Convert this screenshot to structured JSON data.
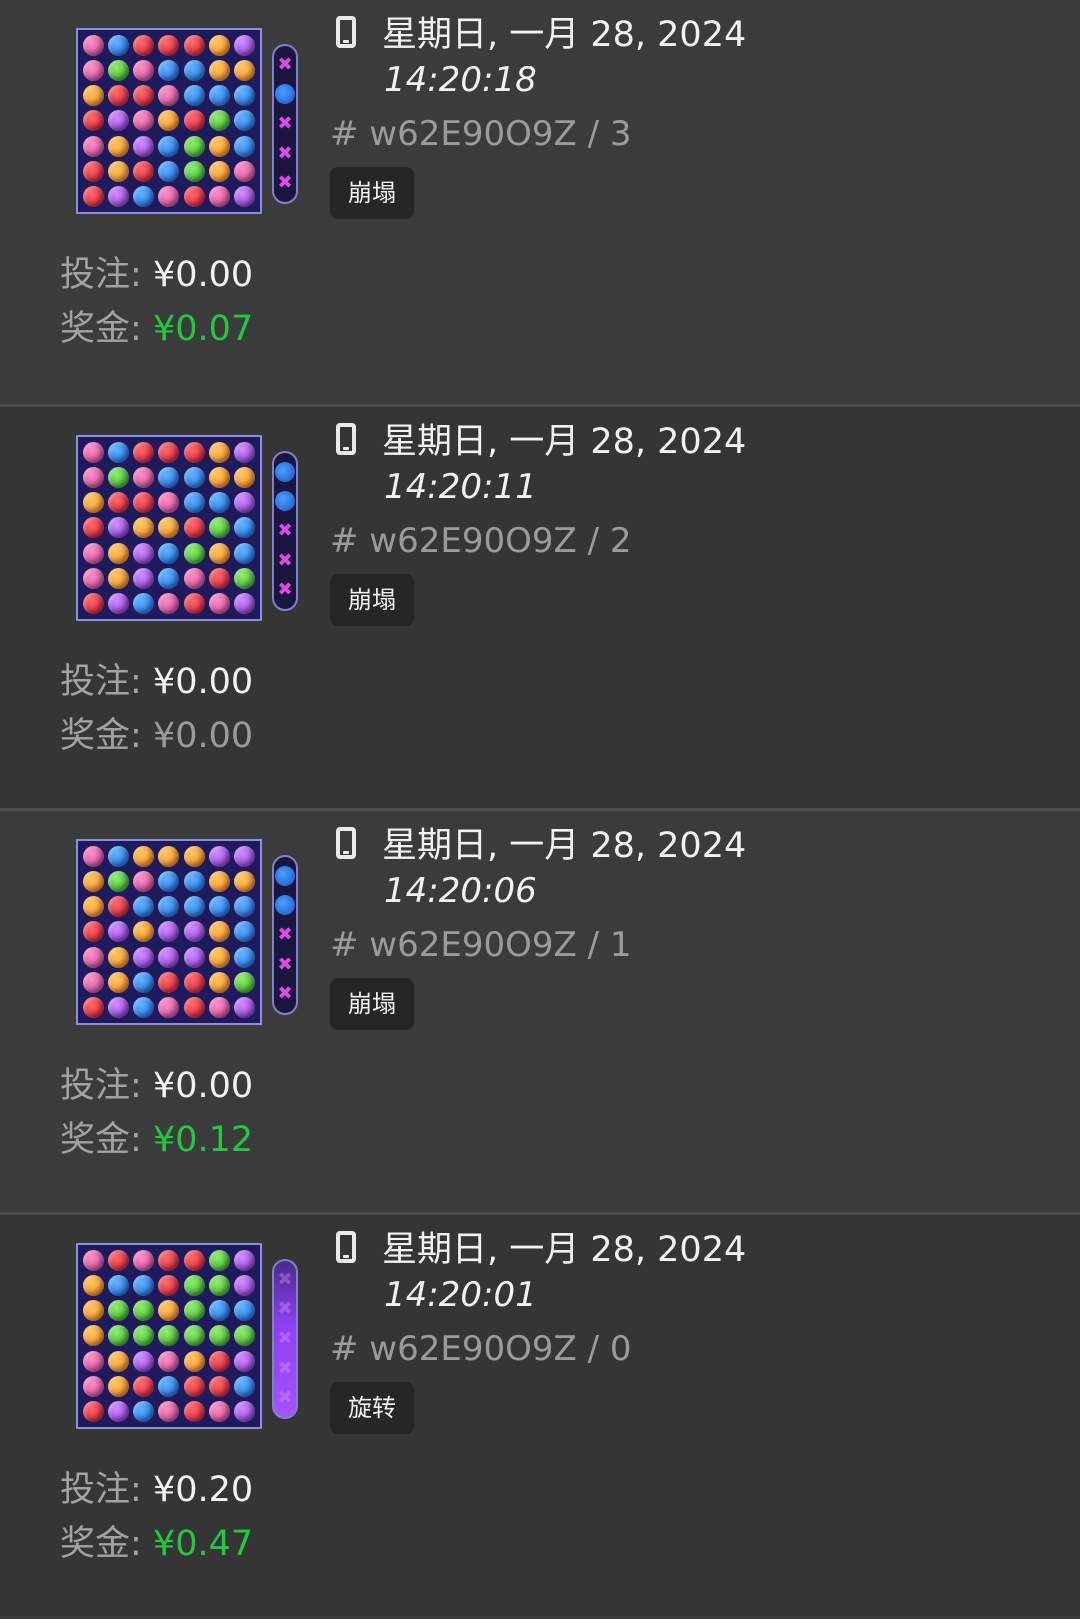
{
  "colors": {
    "background": "#3b3b3b",
    "text": "#f2f2f2",
    "muted": "#9b9b9b",
    "win_positive": "#22c93a",
    "tag_bg": "#262626"
  },
  "icons": {
    "device": "smartphone-icon"
  },
  "labels": {
    "bet": "投注:",
    "win": "奖金:"
  },
  "entries": [
    {
      "date": "星期日, 一月 28, 2024",
      "time": "14:20:18",
      "round_id": "# w62E90O9Z / 3",
      "type": "崩塌",
      "bet": "¥0.00",
      "win": "¥0.07",
      "win_positive": true
    },
    {
      "date": "星期日, 一月 28, 2024",
      "time": "14:20:11",
      "round_id": "# w62E90O9Z / 2",
      "type": "崩塌",
      "bet": "¥0.00",
      "win": "¥0.00",
      "win_positive": false
    },
    {
      "date": "星期日, 一月 28, 2024",
      "time": "14:20:06",
      "round_id": "# w62E90O9Z / 1",
      "type": "崩塌",
      "bet": "¥0.00",
      "win": "¥0.12",
      "win_positive": true
    },
    {
      "date": "星期日, 一月 28, 2024",
      "time": "14:20:01",
      "round_id": "# w62E90O9Z / 0",
      "type": "旋转",
      "bet": "¥0.20",
      "win": "¥0.47",
      "win_positive": true
    }
  ]
}
